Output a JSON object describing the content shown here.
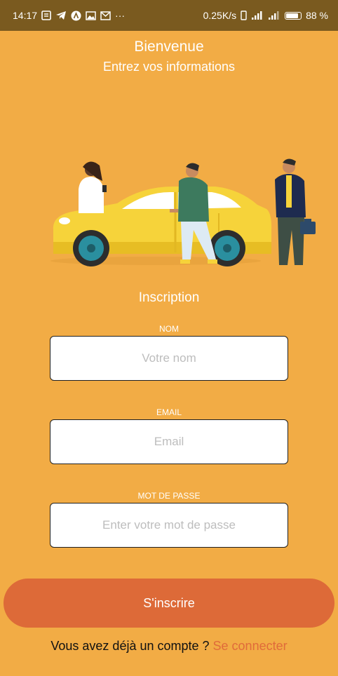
{
  "status_bar": {
    "time": "14:17",
    "more": "···",
    "network_speed": "0.25K/s",
    "battery_percent": "88 %"
  },
  "header": {
    "title": "Bienvenue",
    "subtitle": "Entrez vos informations"
  },
  "form": {
    "section_title": "Inscription",
    "name": {
      "label": "NOM",
      "placeholder": "Votre nom",
      "value": ""
    },
    "email": {
      "label": "EMAIL",
      "placeholder": "Email",
      "value": ""
    },
    "password": {
      "label": "MOT DE PASSE",
      "placeholder": "Enter votre mot de passe",
      "value": ""
    },
    "submit_label": "S'inscrire"
  },
  "footer": {
    "prompt": "Vous avez déjà un compte ? ",
    "login_link": "Se connecter"
  },
  "colors": {
    "background": "#F2AC45",
    "status_bar": "#7A5A1F",
    "button": "#DD6A38",
    "link": "#E06B3A"
  }
}
